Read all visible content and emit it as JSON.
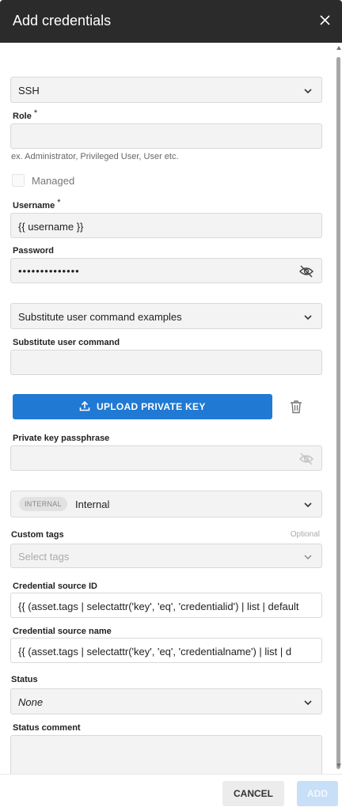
{
  "dialog": {
    "title": "Add credentials",
    "close_icon": "close-icon"
  },
  "form": {
    "auth_type": {
      "value": "SSH"
    },
    "role": {
      "label": "Role",
      "required_mark": "*",
      "value": "",
      "hint": "ex. Administrator, Privileged User, User etc."
    },
    "managed": {
      "label": "Managed",
      "checked": false
    },
    "username": {
      "label": "Username",
      "required_mark": "*",
      "value": "{{ username }}"
    },
    "password": {
      "label": "Password",
      "value": "••••••••••••••",
      "visibility_icon": "eye-off-icon"
    },
    "substitute_examples": {
      "value": "Substitute user command examples"
    },
    "substitute_command": {
      "label": "Substitute user command",
      "value": ""
    },
    "upload_key": {
      "label": "UPLOAD PRIVATE KEY",
      "icon": "upload-icon",
      "delete_icon": "trash-icon"
    },
    "passphrase": {
      "label": "Private key passphrase",
      "value": "",
      "visibility_icon": "eye-off-icon"
    },
    "scope": {
      "badge": "INTERNAL",
      "value": "Internal"
    },
    "custom_tags": {
      "label": "Custom tags",
      "optional": "Optional",
      "placeholder": "Select tags"
    },
    "credential_source_id": {
      "label": "Credential source ID",
      "value": "{{ (asset.tags | selectattr('key', 'eq', 'credentialid') | list | default"
    },
    "credential_source_name": {
      "label": "Credential source name",
      "value": "{{ (asset.tags | selectattr('key', 'eq', 'credentialname') | list | d"
    },
    "status": {
      "label": "Status",
      "value": "None"
    },
    "status_comment": {
      "label": "Status comment",
      "value": ""
    }
  },
  "footer": {
    "cancel_label": "CANCEL",
    "add_label": "ADD"
  },
  "colors": {
    "header_bg": "#2b2b2b",
    "primary": "#2079d2",
    "primary_disabled": "#c7dff7",
    "field_bg": "#f3f3f3"
  }
}
